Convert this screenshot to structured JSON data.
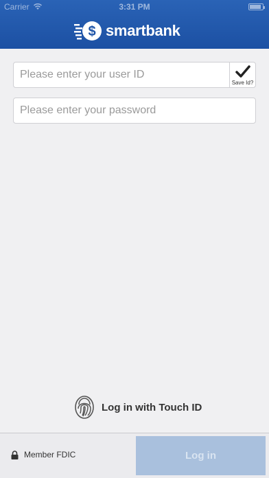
{
  "status_bar": {
    "carrier": "Carrier",
    "time": "3:31 PM"
  },
  "brand": {
    "name": "smartbank",
    "color": "#1f55a8"
  },
  "login_form": {
    "user_id_placeholder": "Please enter your user ID",
    "password_placeholder": "Please enter your password",
    "save_id_label": "Save Id?",
    "save_id_checked": true
  },
  "touch_id": {
    "label": "Log in with Touch ID",
    "icon": "fingerprint-icon"
  },
  "footer": {
    "fdic_label": "Member FDIC",
    "fdic_icon": "lock-icon",
    "login_label": "Log in",
    "login_color": "#a9c0dd"
  }
}
